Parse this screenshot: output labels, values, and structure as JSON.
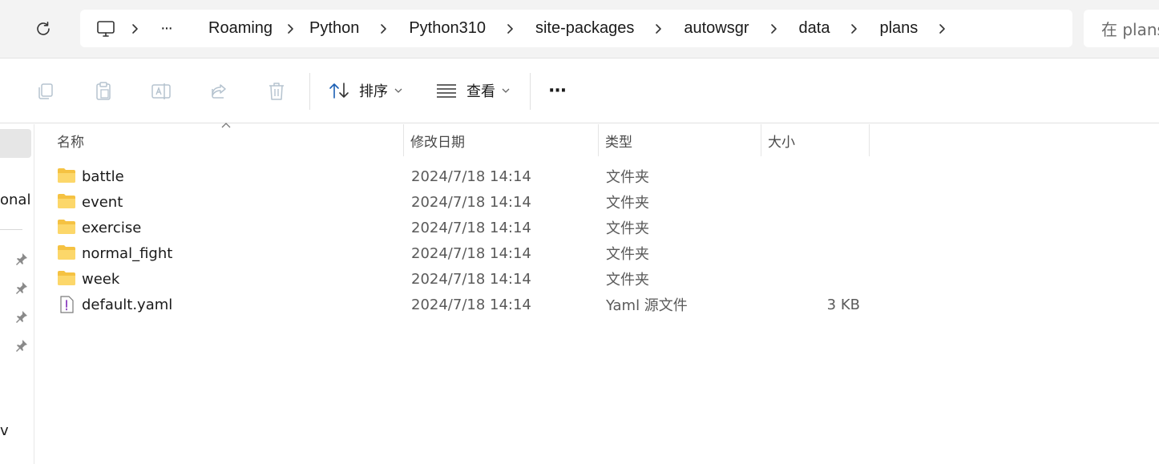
{
  "breadcrumb": {
    "root_icon": "computer-icon",
    "overflow_label": "···",
    "segments": [
      "Roaming",
      "Python",
      "Python310",
      "site-packages",
      "autowsgr",
      "data",
      "plans"
    ]
  },
  "search": {
    "placeholder": "在 plans 中搜索"
  },
  "toolbar": {
    "sort_label": "排序",
    "view_label": "查看",
    "more_label": "···"
  },
  "sidebar": {
    "partial_label_1": "onal",
    "partial_label_2": "v"
  },
  "columns": {
    "name": "名称",
    "modified": "修改日期",
    "type": "类型",
    "size": "大小"
  },
  "files": [
    {
      "name": "battle",
      "modified": "2024/7/18 14:14",
      "type": "文件夹",
      "size": "",
      "icon": "folder-icon"
    },
    {
      "name": "event",
      "modified": "2024/7/18 14:14",
      "type": "文件夹",
      "size": "",
      "icon": "folder-icon"
    },
    {
      "name": "exercise",
      "modified": "2024/7/18 14:14",
      "type": "文件夹",
      "size": "",
      "icon": "folder-icon"
    },
    {
      "name": "normal_fight",
      "modified": "2024/7/18 14:14",
      "type": "文件夹",
      "size": "",
      "icon": "folder-icon"
    },
    {
      "name": "week",
      "modified": "2024/7/18 14:14",
      "type": "文件夹",
      "size": "",
      "icon": "folder-icon"
    },
    {
      "name": "default.yaml",
      "modified": "2024/7/18 14:14",
      "type": "Yaml 源文件",
      "size": "3 KB",
      "icon": "yaml-file-icon"
    }
  ],
  "colors": {
    "folder": "#f5c242",
    "accent": "#0067c0"
  }
}
